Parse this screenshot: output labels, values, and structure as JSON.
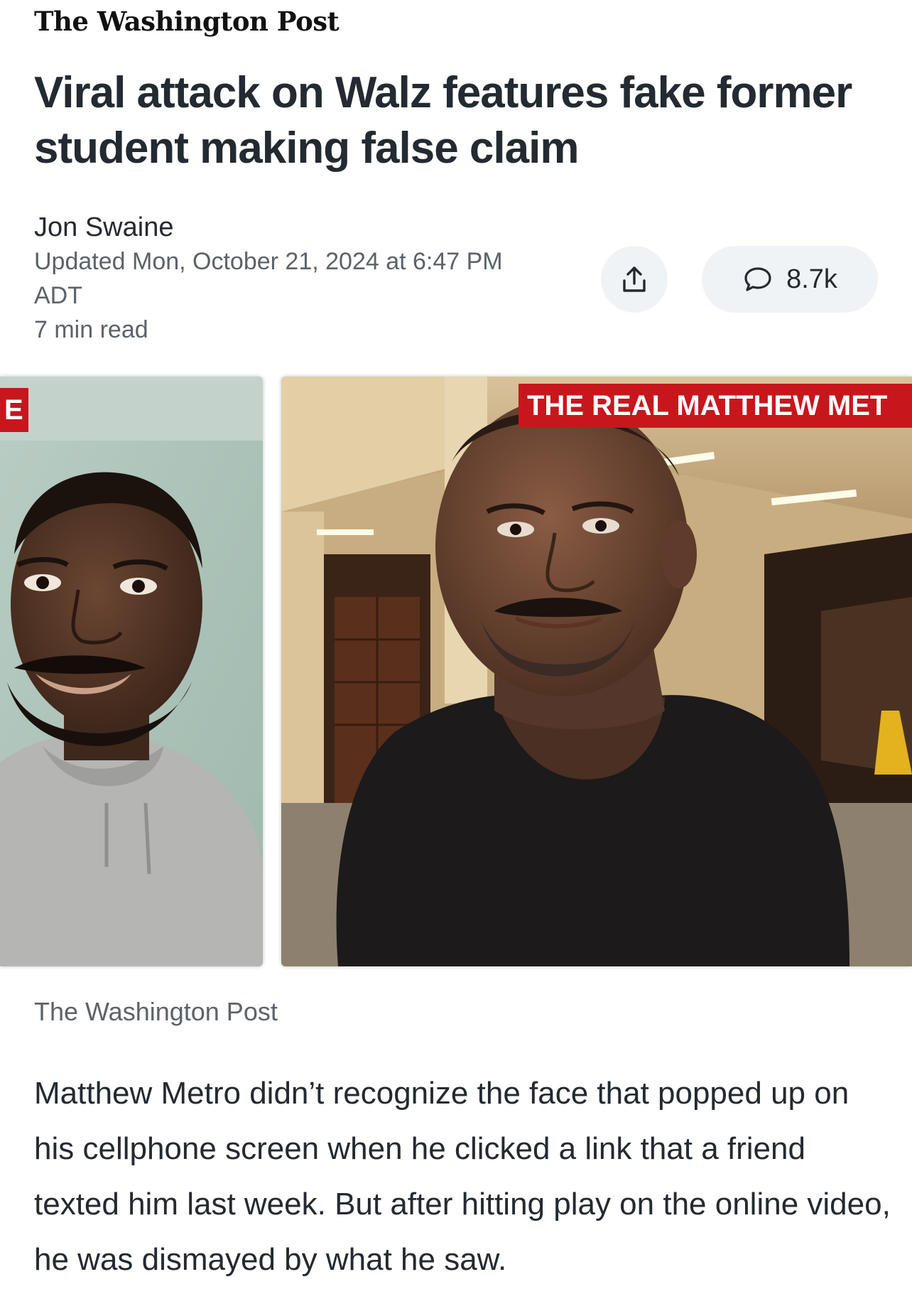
{
  "article": {
    "publisher": "The Washington Post",
    "headline": "Viral attack on Walz features fake former student making false claim",
    "author": "Jon Swaine",
    "updated_line1": "Updated Mon, October 21, 2024 at 6:47 PM",
    "updated_line2": "ADT",
    "read_time": "7 min read",
    "image_tag_left": "E",
    "image_tag_right": "THE REAL MATTHEW MET",
    "image_caption": "The Washington Post",
    "body_paragraph": "Matthew Metro didn’t recognize the face that popped up on his cellphone screen when he clicked a link that a friend texted him last week. But after hitting play on the online video, he was dismayed by what he saw."
  },
  "actions": {
    "share_icon": "share-icon",
    "comments_icon": "comment-bubble-icon",
    "comments_count": "8.7k"
  },
  "colors": {
    "tag_red": "#c8161d",
    "button_bg": "#f0f3f5",
    "text_dark": "#232a31",
    "text_muted": "#5b636a"
  }
}
